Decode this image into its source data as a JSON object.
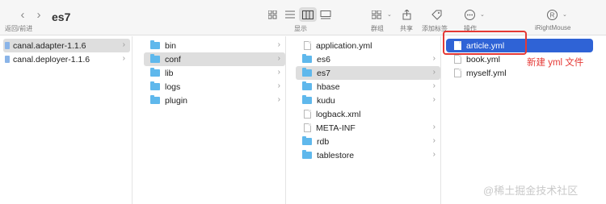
{
  "toolbar": {
    "back_icon": "chevron-left",
    "forward_icon": "chevron-right",
    "nav_label": "返回/前进",
    "title": "es7",
    "view_label": "显示",
    "group_label": "群组",
    "share_label": "共享",
    "tag_label": "添加标签",
    "action_label": "操作",
    "user_label": "iRightMouse"
  },
  "columns": [
    {
      "items": [
        {
          "name": "canal.adapter-1.1.6",
          "type": "doc",
          "selected": true,
          "chevron": true
        },
        {
          "name": "canal.deployer-1.1.6",
          "type": "doc",
          "selected": false,
          "chevron": true
        }
      ]
    },
    {
      "items": [
        {
          "name": "bin",
          "type": "folder",
          "selected": false,
          "chevron": true
        },
        {
          "name": "conf",
          "type": "folder",
          "selected": true,
          "chevron": true
        },
        {
          "name": "lib",
          "type": "folder",
          "selected": false,
          "chevron": true
        },
        {
          "name": "logs",
          "type": "folder",
          "selected": false,
          "chevron": true
        },
        {
          "name": "plugin",
          "type": "folder",
          "selected": false,
          "chevron": true
        }
      ]
    },
    {
      "items": [
        {
          "name": "application.yml",
          "type": "file",
          "selected": false,
          "chevron": false
        },
        {
          "name": "es6",
          "type": "folder",
          "selected": false,
          "chevron": true
        },
        {
          "name": "es7",
          "type": "folder",
          "selected": true,
          "chevron": true
        },
        {
          "name": "hbase",
          "type": "folder",
          "selected": false,
          "chevron": true
        },
        {
          "name": "kudu",
          "type": "folder",
          "selected": false,
          "chevron": true
        },
        {
          "name": "logback.xml",
          "type": "file",
          "selected": false,
          "chevron": false
        },
        {
          "name": "META-INF",
          "type": "folder",
          "selected": false,
          "chevron": true
        },
        {
          "name": "rdb",
          "type": "folder",
          "selected": false,
          "chevron": true
        },
        {
          "name": "tablestore",
          "type": "folder",
          "selected": false,
          "chevron": true
        }
      ]
    },
    {
      "items": [
        {
          "name": "article.yml",
          "type": "file",
          "highlighted": true
        },
        {
          "name": "book.yml",
          "type": "file",
          "highlighted": false
        },
        {
          "name": "myself.yml",
          "type": "file",
          "highlighted": false
        }
      ]
    }
  ],
  "annotation": {
    "text": "新建 yml 文件",
    "color": "#e53935"
  },
  "watermark": "@稀土掘金技术社区",
  "colors": {
    "highlight": "#2f63d6",
    "folder": "#5fb8ec",
    "selected_row": "#dedede"
  }
}
